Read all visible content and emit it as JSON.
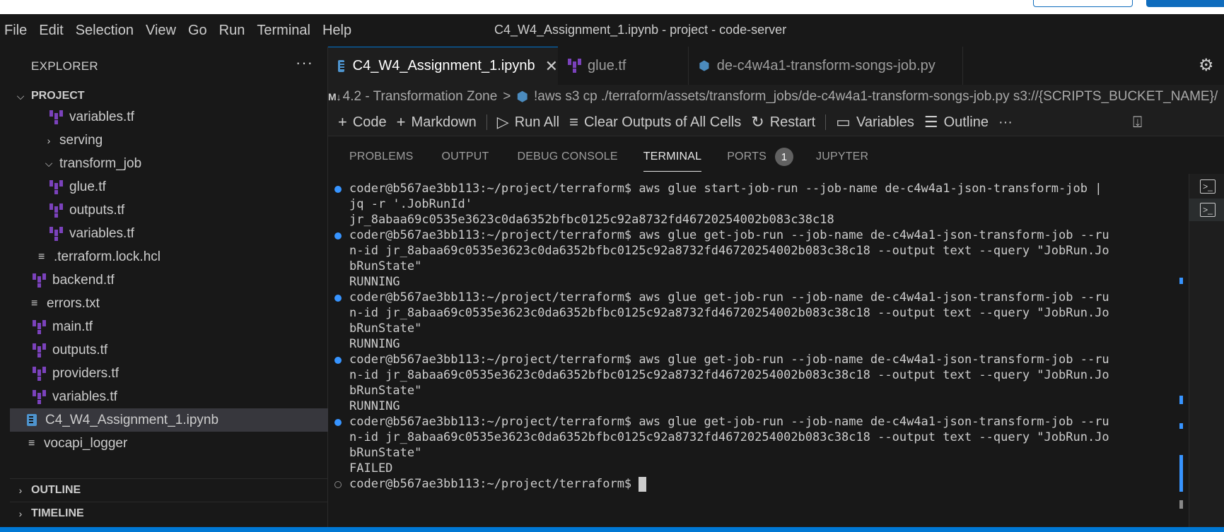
{
  "menubar": {
    "items": [
      "File",
      "Edit",
      "Selection",
      "View",
      "Go",
      "Run",
      "Terminal",
      "Help"
    ],
    "window_title": "C4_W4_Assignment_1.ipynb - project - code-server"
  },
  "sidebar": {
    "title": "EXPLORER",
    "more": "···",
    "project_label": "PROJECT",
    "tree": [
      {
        "label": "variables.tf",
        "kind": "tf"
      },
      {
        "label": "serving",
        "kind": "folder-closed"
      },
      {
        "label": "transform_job",
        "kind": "folder-open"
      },
      {
        "label": "glue.tf",
        "kind": "tf"
      },
      {
        "label": "outputs.tf",
        "kind": "tf"
      },
      {
        "label": "variables.tf",
        "kind": "tf"
      },
      {
        "label": ".terraform.lock.hcl",
        "kind": "text"
      },
      {
        "label": "backend.tf",
        "kind": "tf"
      },
      {
        "label": "errors.txt",
        "kind": "text"
      },
      {
        "label": "main.tf",
        "kind": "tf"
      },
      {
        "label": "outputs.tf",
        "kind": "tf"
      },
      {
        "label": "providers.tf",
        "kind": "tf"
      },
      {
        "label": "variables.tf",
        "kind": "tf"
      },
      {
        "label": "C4_W4_Assignment_1.ipynb",
        "kind": "notebook"
      },
      {
        "label": "vocapi_logger",
        "kind": "text"
      }
    ],
    "outline_label": "OUTLINE",
    "timeline_label": "TIMELINE"
  },
  "tabs": [
    {
      "label": "C4_W4_Assignment_1.ipynb",
      "close": "✕"
    },
    {
      "label": "glue.tf"
    },
    {
      "label": "de-c4w4a1-transform-songs-job.py"
    }
  ],
  "breadcrumb": {
    "md_icon": "M↓",
    "section": "4.2 - Transformation Zone",
    "sep": ">",
    "cell": "!aws s3 cp ./terraform/assets/transform_jobs/de-c4w4a1-transform-songs-job.py s3://{SCRIPTS_BUCKET_NAME}/"
  },
  "toolbar": {
    "code": "Code",
    "markdown": "Markdown",
    "run_all": "Run All",
    "clear": "Clear Outputs of All Cells",
    "restart": "Restart",
    "variables": "Variables",
    "outline": "Outline",
    "more": "···"
  },
  "panel": {
    "tabs": [
      "PROBLEMS",
      "OUTPUT",
      "DEBUG CONSOLE",
      "TERMINAL",
      "PORTS",
      "JUPYTER"
    ],
    "ports_badge": "1"
  },
  "terminal": {
    "lines": [
      "coder@b567ae3bb113:~/project/terraform$ aws glue start-job-run --job-name de-c4w4a1-json-transform-job |",
      "jq -r '.JobRunId'",
      "jr_8abaa69c0535e3623c0da6352bfbc0125c92a8732fd46720254002b083c38c18",
      "coder@b567ae3bb113:~/project/terraform$ aws glue get-job-run --job-name de-c4w4a1-json-transform-job --ru",
      "n-id jr_8abaa69c0535e3623c0da6352bfbc0125c92a8732fd46720254002b083c38c18 --output text --query \"JobRun.Jo",
      "bRunState\"",
      "RUNNING",
      "coder@b567ae3bb113:~/project/terraform$ aws glue get-job-run --job-name de-c4w4a1-json-transform-job --ru",
      "n-id jr_8abaa69c0535e3623c0da6352bfbc0125c92a8732fd46720254002b083c38c18 --output text --query \"JobRun.Jo",
      "bRunState\"",
      "RUNNING",
      "coder@b567ae3bb113:~/project/terraform$ aws glue get-job-run --job-name de-c4w4a1-json-transform-job --ru",
      "n-id jr_8abaa69c0535e3623c0da6352bfbc0125c92a8732fd46720254002b083c38c18 --output text --query \"JobRun.Jo",
      "bRunState\"",
      "RUNNING",
      "coder@b567ae3bb113:~/project/terraform$ aws glue get-job-run --job-name de-c4w4a1-json-transform-job --ru",
      "n-id jr_8abaa69c0535e3623c0da6352bfbc0125c92a8732fd46720254002b083c38c18 --output text --query \"JobRun.Jo",
      "bRunState\"",
      "FAILED",
      "coder@b567ae3bb113:~/project/terraform$ "
    ]
  },
  "colors": {
    "accent": "#0078d4",
    "terraform": "#7b42bc",
    "command_dot": "#3794ff"
  }
}
